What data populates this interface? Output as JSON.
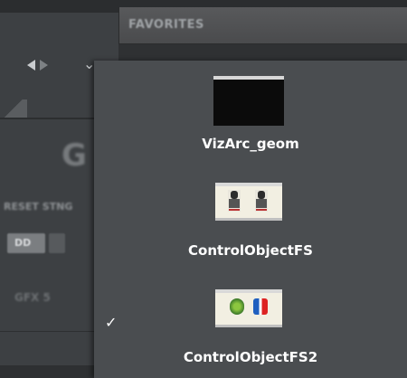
{
  "header": {
    "favorites_label": "FAVORITES"
  },
  "left_panel": {
    "big_letter": "G",
    "reset_label": "RESET STNG",
    "button1_label": "DD",
    "gfx_label": "GFX 5"
  },
  "popup": {
    "items": [
      {
        "label": "VizArc_geom",
        "thumbnail": "black-geometry-thumbnail",
        "checked": false
      },
      {
        "label": "ControlObjectFS",
        "thumbnail": "controlobject-players-thumbnail",
        "checked": false
      },
      {
        "label": "ControlObjectFS2",
        "thumbnail": "controlobject-badges-thumbnail",
        "checked": true
      }
    ],
    "check_glyph": "✓"
  },
  "colors": {
    "popup_bg": "#4a4d50",
    "panel_bg": "#3d4043",
    "text": "#ffffff"
  }
}
